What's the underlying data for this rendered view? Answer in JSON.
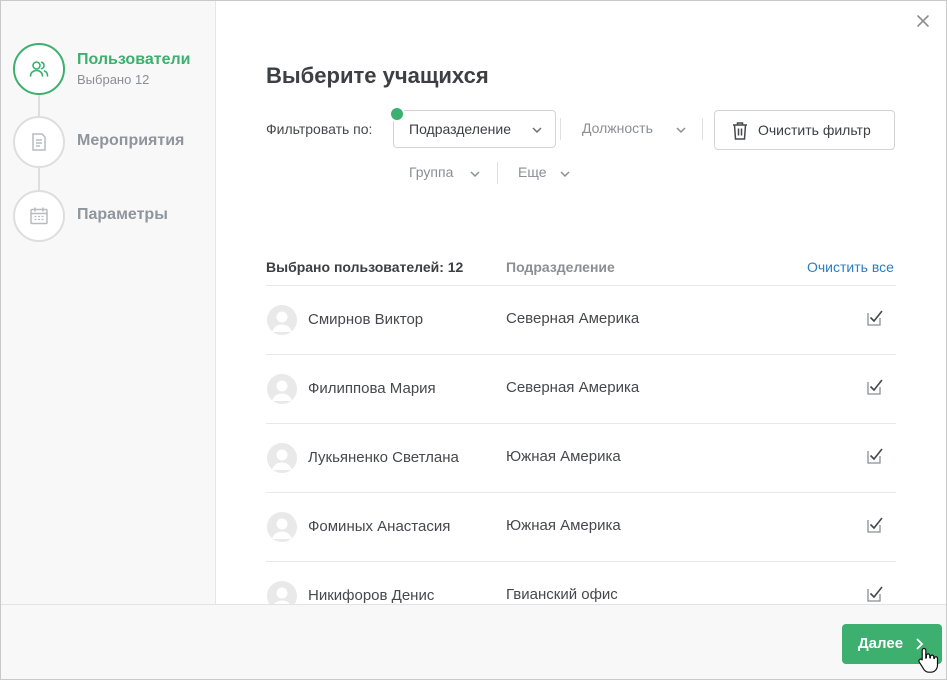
{
  "sidebar": {
    "steps": [
      {
        "title": "Пользователи",
        "subtitle": "Выбрано 12",
        "icon": "users-icon",
        "active": true
      },
      {
        "title": "Мероприятия",
        "icon": "document-icon",
        "active": false
      },
      {
        "title": "Параметры",
        "icon": "calendar-icon",
        "active": false
      }
    ]
  },
  "main": {
    "title": "Выберите учащихся",
    "filter_label": "Фильтровать по:",
    "filters": {
      "department": "Подразделение",
      "position": "Должность",
      "group": "Группа",
      "more": "Еще"
    },
    "clear_filter": "Очистить фильтр"
  },
  "table": {
    "selected_count_label": "Выбрано пользователей: 12",
    "dept_header": "Подразделение",
    "clear_all": "Очистить все",
    "rows": [
      {
        "name": "Смирнов Виктор",
        "dept": "Северная Америка",
        "checked": true
      },
      {
        "name": "Филиппова Мария",
        "dept": "Северная Америка",
        "checked": true
      },
      {
        "name": "Лукьяненко Светлана",
        "dept": "Южная Америка",
        "checked": true
      },
      {
        "name": "Фоминых Анастасия",
        "dept": "Южная Америка",
        "checked": true
      },
      {
        "name": "Никифоров Денис",
        "dept": "Гвианский офис",
        "checked": true
      }
    ]
  },
  "footer": {
    "next_label": "Далее"
  },
  "colors": {
    "accent": "#3daf6e",
    "link": "#2b7ec3"
  }
}
